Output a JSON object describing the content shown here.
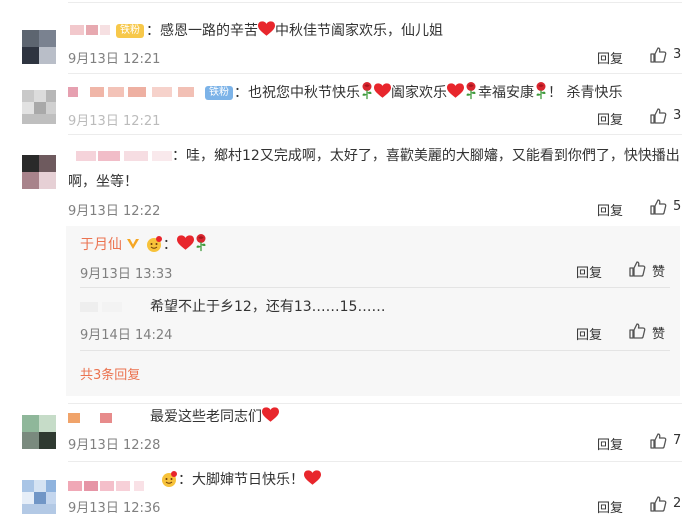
{
  "actions": {
    "reply": "回复"
  },
  "comments": [
    {
      "badge": "铁粉",
      "text": "：感恩一路的辛苦",
      "text2": "中秋佳节阖家欢乐，仙儿姐",
      "time": "9月13日 12:21",
      "likes": "3"
    },
    {
      "badge": "铁粉",
      "text": "：也祝您中秋节快乐",
      "text2": "阖家欢乐",
      "text3": "幸福安康",
      "text4": "！ 杀青快乐",
      "time": "9月13日 12:21",
      "likes": "3"
    },
    {
      "text": "：哇，鄉村12又完成啊，太好了，喜歡美麗的大腳嬸，又能看到你們了，快快播出",
      "text_line2": "啊，坐等！",
      "time": "9月13日 12:22",
      "likes": "5"
    },
    {
      "text": "最爱这些老同志们",
      "time": "9月13日 12:28",
      "likes": "7"
    },
    {
      "text": "：大脚婶节日快乐！",
      "time": "9月13日 12:36",
      "likes": "2"
    }
  ],
  "replies": [
    {
      "name": "于月仙",
      "text": "：",
      "time": "9月13日 13:33",
      "likes": "赞"
    },
    {
      "text": "希望不止于乡12，还有13……15……",
      "time": "9月14日 14:24",
      "likes": "赞"
    }
  ],
  "more_replies": "共3条回复",
  "colors": {
    "accent": "#eb7350",
    "heart": "#e8262c",
    "badge": "#7cb3e8"
  }
}
